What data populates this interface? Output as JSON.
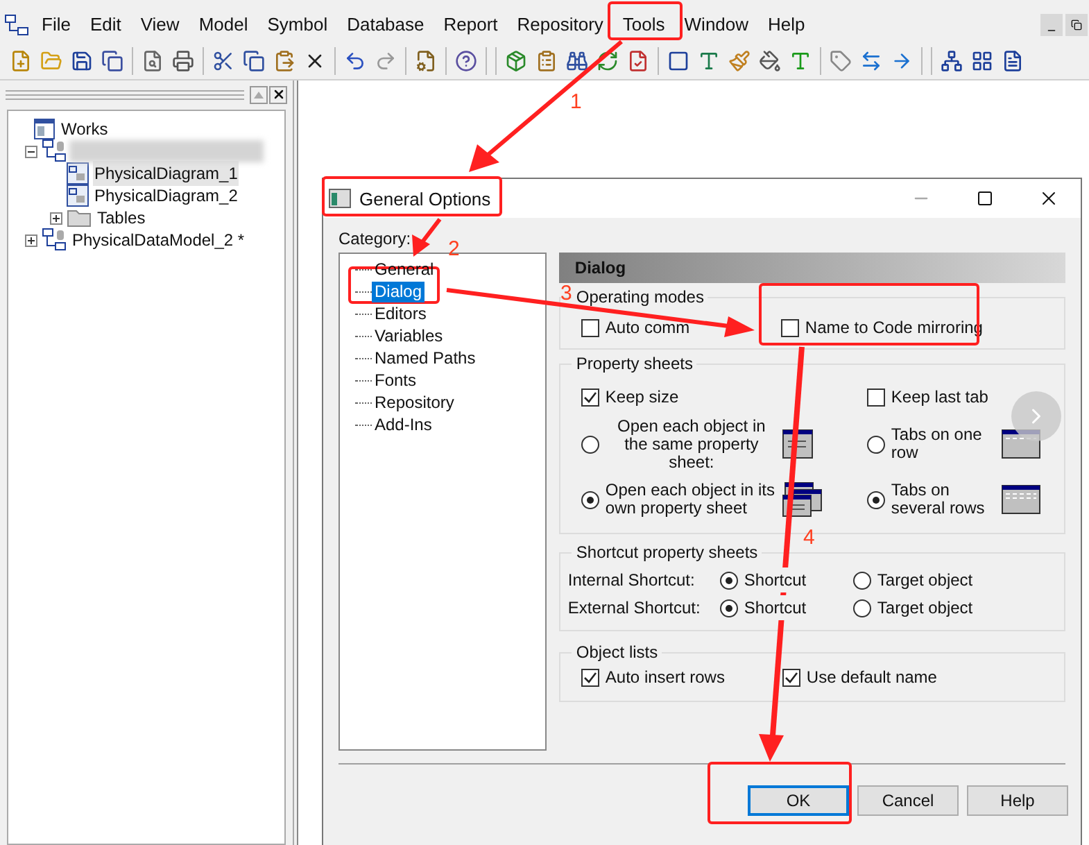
{
  "menu_bar": [
    "File",
    "Edit",
    "View",
    "Model",
    "Symbol",
    "Database",
    "Report",
    "Repository",
    "Tools",
    "Window",
    "Help"
  ],
  "workspace_tree": [
    {
      "kind": "workspace",
      "label": "Works",
      "children": [
        {
          "kind": "blurred",
          "expanded": true,
          "children": [
            {
              "kind": "diagram",
              "label": "PhysicalDiagram_1",
              "selected": true
            },
            {
              "kind": "diagram",
              "label": "PhysicalDiagram_2",
              "selected": false
            },
            {
              "kind": "folder",
              "label": "Tables",
              "expanded": false,
              "selected": false
            }
          ]
        },
        {
          "kind": "model",
          "label": "PhysicalDataModel_2 *",
          "expanded": false,
          "selected": false
        }
      ]
    }
  ],
  "dialog": {
    "title": "General Options",
    "category_label": "Category:",
    "categories": [
      {
        "label": "General",
        "selected": false
      },
      {
        "label": "Dialog",
        "selected": true
      },
      {
        "label": "Editors",
        "selected": false
      },
      {
        "label": "Variables",
        "selected": false
      },
      {
        "label": "Named Paths",
        "selected": false
      },
      {
        "label": "Fonts",
        "selected": false
      },
      {
        "label": "Repository",
        "selected": false
      },
      {
        "label": "Add-Ins",
        "selected": false
      }
    ],
    "header": "Dialog",
    "operating_modes": {
      "title": "Operating modes",
      "options": [
        {
          "label": "Auto comm",
          "checked": false
        },
        {
          "label": "Name to Code mirroring",
          "checked": false
        }
      ]
    },
    "property_sheets": {
      "title": "Property sheets",
      "keep_size": {
        "label": "Keep size",
        "checked": true
      },
      "keep_last_tab": {
        "label": "Keep last tab",
        "checked": false
      },
      "open_modes": [
        {
          "label": "Open each object in the same property sheet:",
          "selected": false
        },
        {
          "label": "Open each object in its own property sheet",
          "selected": true
        }
      ],
      "tab_modes": [
        {
          "label": "Tabs on one row",
          "selected": false
        },
        {
          "label": "Tabs on several rows",
          "selected": true
        }
      ]
    },
    "shortcut_property_sheets": {
      "title": "Shortcut property sheets",
      "rows": [
        {
          "label": "Internal Shortcut:",
          "options": [
            {
              "label": "Shortcut",
              "selected": true
            },
            {
              "label": "Target object",
              "selected": false
            }
          ]
        },
        {
          "label": "External Shortcut:",
          "options": [
            {
              "label": "Shortcut",
              "selected": true
            },
            {
              "label": "Target object",
              "selected": false
            }
          ]
        }
      ]
    },
    "object_lists": {
      "title": "Object lists",
      "options": [
        {
          "label": "Auto insert rows",
          "checked": true
        },
        {
          "label": "Use default name",
          "checked": true
        }
      ]
    },
    "buttons": [
      {
        "label": "OK",
        "default": true
      },
      {
        "label": "Cancel",
        "default": false
      },
      {
        "label": "Help",
        "default": false
      }
    ]
  },
  "annotations": {
    "steps": [
      "1",
      "2",
      "3",
      "4"
    ]
  }
}
